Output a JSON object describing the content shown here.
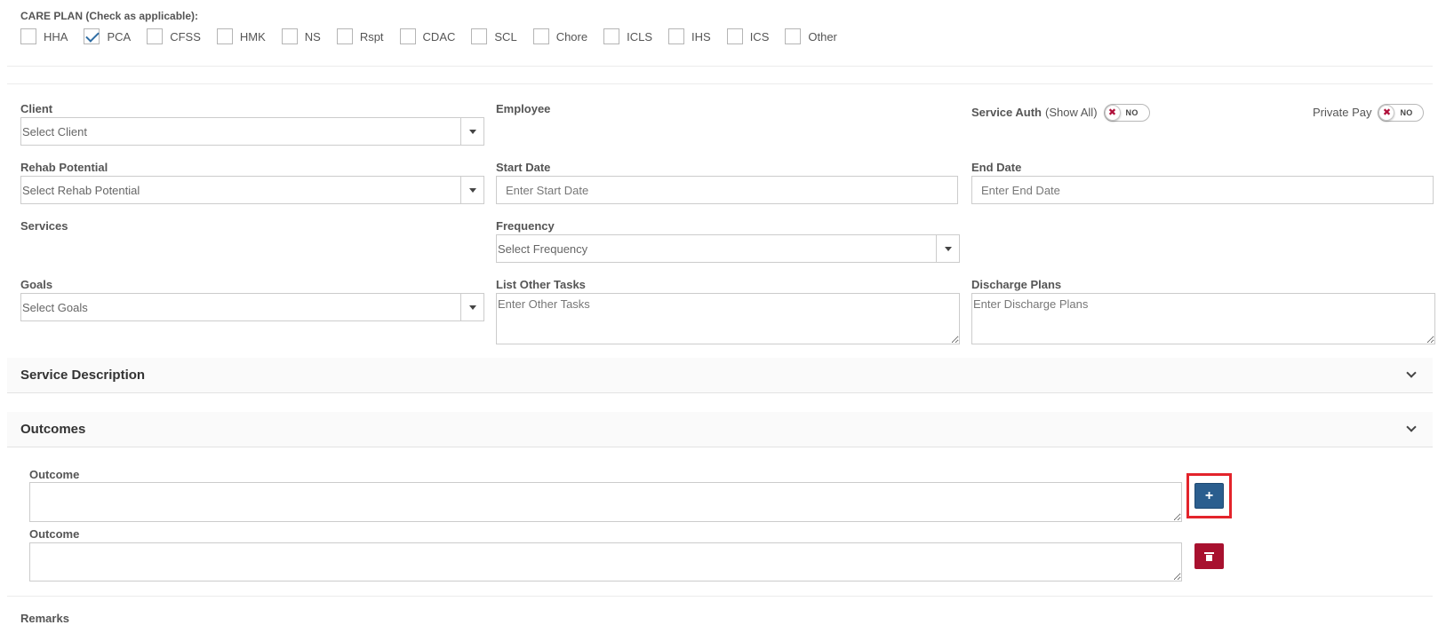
{
  "care_plan": {
    "title": "CARE PLAN (Check as applicable):",
    "options": [
      {
        "label": "HHA",
        "checked": false
      },
      {
        "label": "PCA",
        "checked": true
      },
      {
        "label": "CFSS",
        "checked": false
      },
      {
        "label": "HMK",
        "checked": false
      },
      {
        "label": "NS",
        "checked": false
      },
      {
        "label": "Rspt",
        "checked": false
      },
      {
        "label": "CDAC",
        "checked": false
      },
      {
        "label": "SCL",
        "checked": false
      },
      {
        "label": "Chore",
        "checked": false
      },
      {
        "label": "ICLS",
        "checked": false
      },
      {
        "label": "IHS",
        "checked": false
      },
      {
        "label": "ICS",
        "checked": false
      },
      {
        "label": "Other",
        "checked": false
      }
    ]
  },
  "form": {
    "client": {
      "label": "Client",
      "placeholder": "Select Client"
    },
    "employee": {
      "label": "Employee"
    },
    "service_auth": {
      "label": "Service Auth",
      "suffix": "(Show All)",
      "toggle_text": "NO"
    },
    "private_pay": {
      "label": "Private Pay",
      "toggle_text": "NO"
    },
    "rehab_potential": {
      "label": "Rehab Potential",
      "placeholder": "Select Rehab Potential"
    },
    "start_date": {
      "label": "Start Date",
      "placeholder": "Enter Start Date"
    },
    "end_date": {
      "label": "End Date",
      "placeholder": "Enter End Date"
    },
    "services": {
      "label": "Services"
    },
    "frequency": {
      "label": "Frequency",
      "placeholder": "Select Frequency"
    },
    "goals": {
      "label": "Goals",
      "placeholder": "Select Goals"
    },
    "other_tasks": {
      "label": "List Other Tasks",
      "placeholder": "Enter Other Tasks"
    },
    "discharge_plans": {
      "label": "Discharge Plans",
      "placeholder": "Enter Discharge Plans"
    }
  },
  "sections": {
    "service_description": "Service Description",
    "outcomes": "Outcomes"
  },
  "outcomes": {
    "items": [
      {
        "label": "Outcome",
        "value": "",
        "action": "add"
      },
      {
        "label": "Outcome",
        "value": "",
        "action": "delete"
      }
    ],
    "add_symbol": "+"
  },
  "remarks": {
    "label": "Remarks"
  },
  "colors": {
    "add_button": "#2b5e8e",
    "delete_button": "#a8112f",
    "highlight": "#e3242b",
    "checkbox_check": "#2f6da3"
  }
}
